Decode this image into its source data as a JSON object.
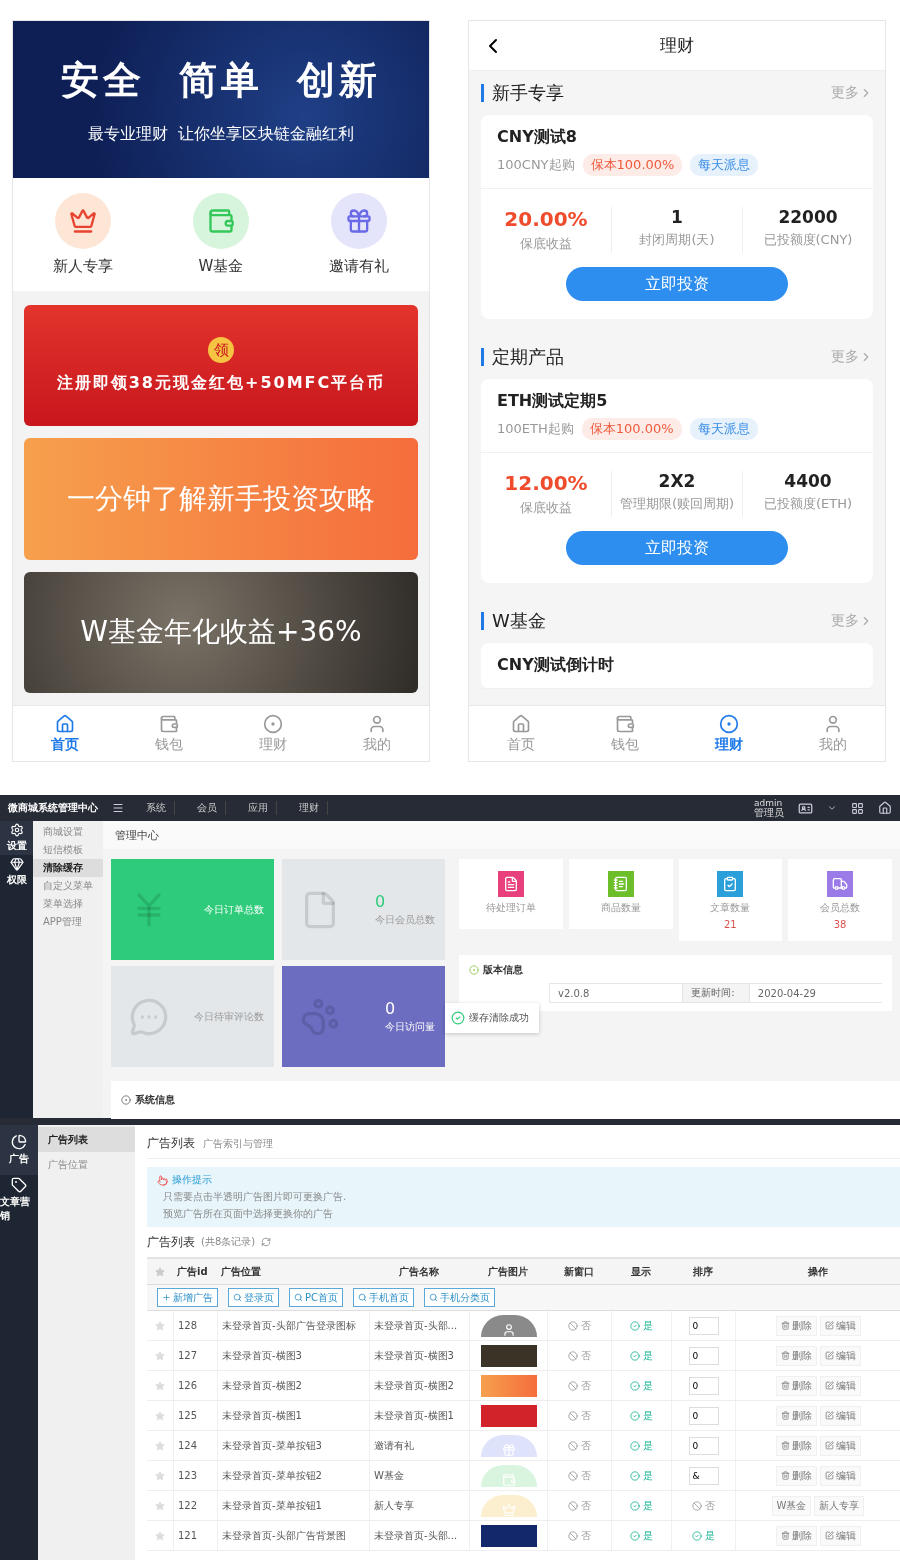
{
  "mobile_home": {
    "banner": {
      "title": "安全  简单  创新",
      "subtitle": "最专业理财  让你坐享区块链金融红利"
    },
    "shortcuts": [
      {
        "label": "新人专享"
      },
      {
        "label": "W基金"
      },
      {
        "label": "邀请有礼"
      }
    ],
    "promos": [
      {
        "kind": "red",
        "badge": "领",
        "text": "注册即领38元现金红包+50MFC平台币"
      },
      {
        "kind": "orange",
        "text": "一分钟了解新手投资攻略"
      },
      {
        "kind": "coins",
        "text": "W基金年化收益+36%"
      }
    ],
    "tab_bar": [
      {
        "label": "首页",
        "selected": true
      },
      {
        "label": "钱包",
        "selected": false
      },
      {
        "label": "理财",
        "selected": false
      },
      {
        "label": "我的",
        "selected": false
      }
    ]
  },
  "mobile_invest": {
    "title": "理财",
    "sections": [
      {
        "title": "新手专享",
        "more": "更多",
        "product": {
          "name": "CNY测试8",
          "min": "100CNY起购",
          "tags": [
            {
              "text": "保本100.00%",
              "color": "#f05a3c"
            },
            {
              "text": "每天派息",
              "color": "#3a8ee6"
            }
          ],
          "stats": [
            {
              "value": "20.00%",
              "label": "保底收益"
            },
            {
              "value": "1",
              "label": "封闭周期(天)"
            },
            {
              "value": "22000",
              "label": "已投额度(CNY)"
            }
          ],
          "button": "立即投资"
        }
      },
      {
        "title": "定期产品",
        "more": "更多",
        "product": {
          "name": "ETH测试定期5",
          "min": "100ETH起购",
          "tags": [
            {
              "text": "保本100.00%",
              "color": "#f05a3c"
            },
            {
              "text": "每天派息",
              "color": "#3a8ee6"
            }
          ],
          "stats": [
            {
              "value": "12.00%",
              "label": "保底收益"
            },
            {
              "value": "2X2",
              "label": "管理期限(赎回周期)"
            },
            {
              "value": "4400",
              "label": "已投额度(ETH)"
            }
          ],
          "button": "立即投资"
        }
      },
      {
        "title": "W基金",
        "more": "更多",
        "product": {
          "name": "CNY测试倒计时"
        }
      }
    ],
    "tab_bar": [
      {
        "label": "首页",
        "selected": false
      },
      {
        "label": "钱包",
        "selected": false
      },
      {
        "label": "理财",
        "selected": true
      },
      {
        "label": "我的",
        "selected": false
      }
    ]
  },
  "admin": {
    "brand": "微商城系统管理中心",
    "nav": [
      "系统",
      "会员",
      "应用",
      "理财"
    ],
    "user": {
      "name": "admin",
      "role": "管理员"
    },
    "rail": [
      {
        "label": "设置",
        "selected": true
      },
      {
        "label": "权限",
        "selected": false
      }
    ],
    "submenu": [
      {
        "label": "商城设置",
        "selected": false
      },
      {
        "label": "短信模板",
        "selected": false
      },
      {
        "label": "清除缓存",
        "selected": true
      },
      {
        "label": "自定义菜单",
        "selected": false
      },
      {
        "label": "菜单选择",
        "selected": false
      },
      {
        "label": "APP管理",
        "selected": false
      }
    ],
    "page_title": "管理中心",
    "tiles": [
      {
        "kind": "green",
        "label": "今日订单总数"
      },
      {
        "kind": "grey",
        "value": "0",
        "label": "今日会员总数"
      },
      {
        "kind": "grey",
        "label": "今日待审评论数"
      },
      {
        "kind": "purple",
        "value": "0",
        "label": "今日访问量"
      }
    ],
    "stat_cards": [
      {
        "label": "待处理订单"
      },
      {
        "label": "商品数量"
      },
      {
        "label": "文章数量",
        "value": "21"
      },
      {
        "label": "会员总数",
        "value": "38"
      }
    ],
    "version": {
      "title": "版本信息",
      "cells": [
        "v2.0.8",
        "更新时间:",
        "2020-04-29"
      ]
    },
    "toast": "缓存清除成功",
    "system_title": "系统信息"
  },
  "ads": {
    "rail": [
      {
        "label": "广告",
        "selected": true
      },
      {
        "label": "文章营销",
        "selected": false
      }
    ],
    "submenu": [
      {
        "label": "广告列表",
        "selected": true
      },
      {
        "label": "广告位置",
        "selected": false
      }
    ],
    "title": "广告列表",
    "subtitle": "广告索引与管理",
    "tips": {
      "title": "操作提示",
      "items": [
        "只需要点击半透明广告图片即可更换广告.",
        "预览广告所在页面中选择更换你的广告"
      ]
    },
    "list_title": "广告列表",
    "record_count": "(共8条记录)",
    "columns": [
      "广告id",
      "广告位置",
      "广告名称",
      "广告图片",
      "新窗口",
      "显示",
      "排序",
      "操作"
    ],
    "actions": [
      {
        "label": "新增广告",
        "kind": "add"
      },
      {
        "label": "登录页",
        "kind": "search"
      },
      {
        "label": "PC首页",
        "kind": "search"
      },
      {
        "label": "手机首页",
        "kind": "search"
      },
      {
        "label": "手机分类页",
        "kind": "search"
      }
    ],
    "rows": [
      {
        "id": "128",
        "position": "未登录首页-头部广告登录图标",
        "name": "未登录首页-头部...",
        "new_window": {
          "text": "否",
          "on": false
        },
        "display": {
          "text": "是",
          "on": true
        },
        "sort": {
          "kind": "input",
          "value": "0"
        },
        "ops": [
          {
            "label": "删除",
            "kind": "delete"
          },
          {
            "label": "编辑",
            "kind": "edit"
          }
        ]
      },
      {
        "id": "127",
        "position": "未登录首页-横图3",
        "name": "未登录首页-横图3",
        "new_window": {
          "text": "否",
          "on": false
        },
        "display": {
          "text": "是",
          "on": true
        },
        "sort": {
          "kind": "input",
          "value": "0"
        },
        "ops": [
          {
            "label": "删除",
            "kind": "delete"
          },
          {
            "label": "编辑",
            "kind": "edit"
          }
        ]
      },
      {
        "id": "126",
        "position": "未登录首页-横图2",
        "name": "未登录首页-横图2",
        "new_window": {
          "text": "否",
          "on": false
        },
        "display": {
          "text": "是",
          "on": true
        },
        "sort": {
          "kind": "input",
          "value": "0"
        },
        "ops": [
          {
            "label": "删除",
            "kind": "delete"
          },
          {
            "label": "编辑",
            "kind": "edit"
          }
        ]
      },
      {
        "id": "125",
        "position": "未登录首页-横图1",
        "name": "未登录首页-横图1",
        "new_window": {
          "text": "否",
          "on": false
        },
        "display": {
          "text": "是",
          "on": true
        },
        "sort": {
          "kind": "input",
          "value": "0"
        },
        "ops": [
          {
            "label": "删除",
            "kind": "delete"
          },
          {
            "label": "编辑",
            "kind": "edit"
          }
        ]
      },
      {
        "id": "124",
        "position": "未登录首页-菜单按钮3",
        "name": "邀请有礼",
        "new_window": {
          "text": "否",
          "on": false
        },
        "display": {
          "text": "是",
          "on": true
        },
        "sort": {
          "kind": "input",
          "value": "0"
        },
        "ops": [
          {
            "label": "删除",
            "kind": "delete"
          },
          {
            "label": "编辑",
            "kind": "edit"
          }
        ]
      },
      {
        "id": "123",
        "position": "未登录首页-菜单按钮2",
        "name": "W基金",
        "new_window": {
          "text": "否",
          "on": false
        },
        "display": {
          "text": "是",
          "on": true
        },
        "sort": {
          "kind": "input",
          "value": "&"
        },
        "ops": [
          {
            "label": "删除",
            "kind": "delete"
          },
          {
            "label": "编辑",
            "kind": "edit"
          }
        ]
      },
      {
        "id": "122",
        "position": "未登录首页-菜单按钮1",
        "name": "新人专享",
        "new_window": {
          "text": "否",
          "on": false
        },
        "display": {
          "text": "是",
          "on": true
        },
        "sort": {
          "kind": "status",
          "text": "否",
          "on": false
        },
        "ops": [
          {
            "label": "W基金",
            "kind": "text"
          },
          {
            "label": "新人专享",
            "kind": "text"
          }
        ]
      },
      {
        "id": "121",
        "position": "未登录首页-头部广告背景图",
        "name": "未登录首页-头部...",
        "new_window": {
          "text": "否",
          "on": false
        },
        "display": {
          "text": "是",
          "on": true
        },
        "sort": {
          "kind": "status",
          "text": "是",
          "on": true
        },
        "ops": [
          {
            "label": "删除",
            "kind": "delete"
          },
          {
            "label": "编辑",
            "kind": "edit"
          }
        ]
      }
    ]
  }
}
